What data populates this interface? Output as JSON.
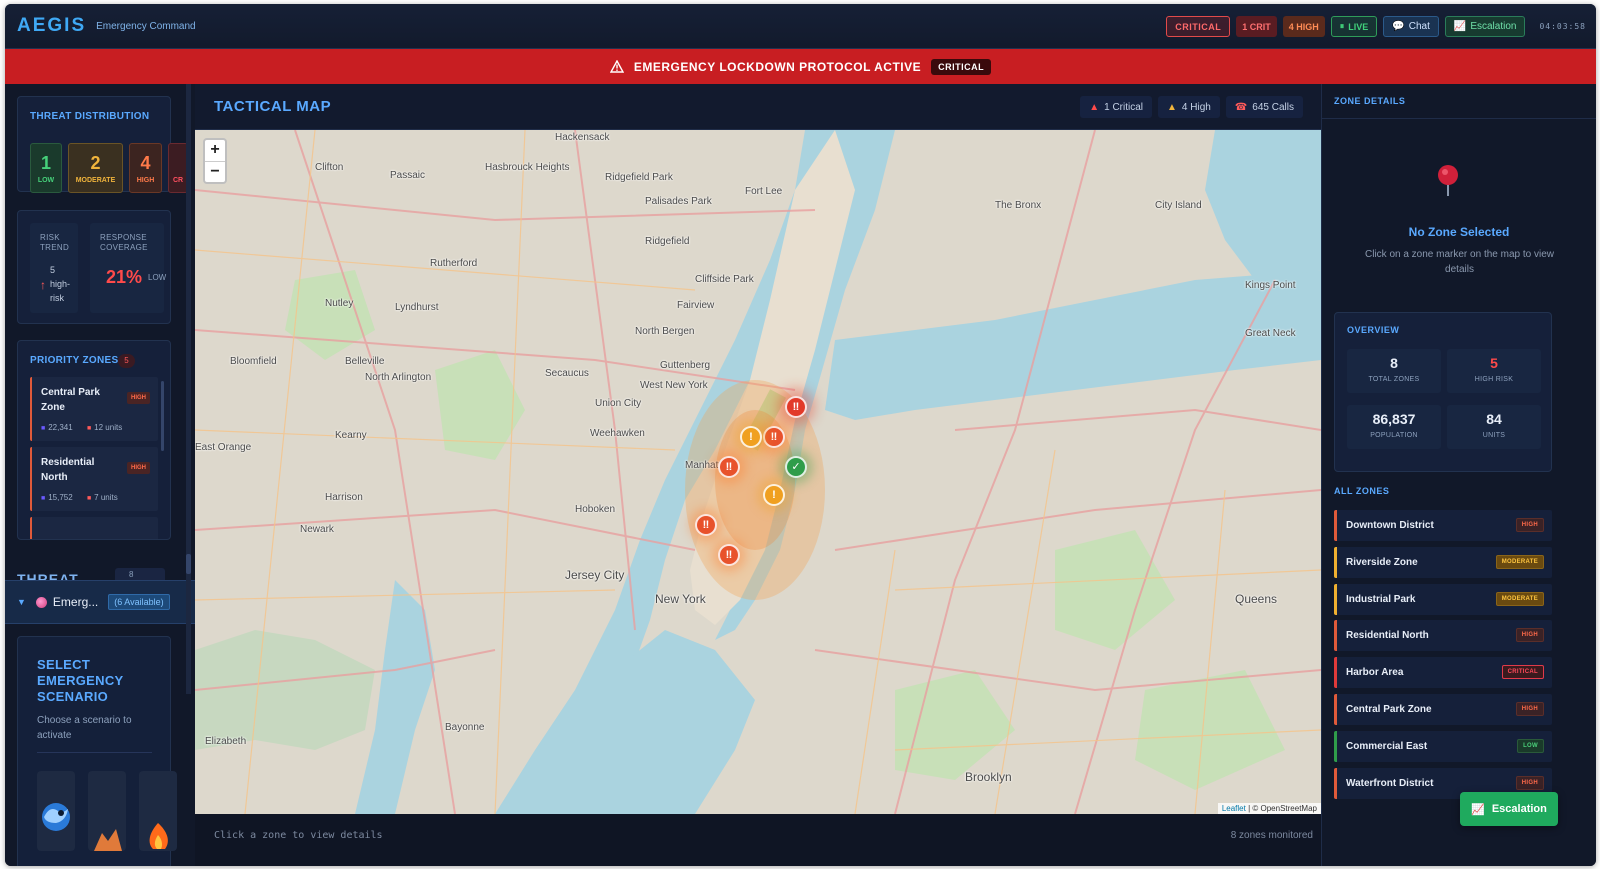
{
  "header": {
    "logo": "AEGIS",
    "subtitle": "Emergency Command",
    "critical_pill": "CRITICAL",
    "crit_count": "1 CRIT",
    "high_count": "4 HIGH",
    "live": "LIVE",
    "chat": "Chat",
    "escalation": "Escalation",
    "clock": "04:03:58"
  },
  "banner": {
    "text": "EMERGENCY LOCKDOWN PROTOCOL ACTIVE",
    "badge": "CRITICAL"
  },
  "left": {
    "threat_distribution": {
      "title": "THREAT DISTRIBUTION",
      "low": {
        "value": "1",
        "label": "LOW"
      },
      "moderate": {
        "value": "2",
        "label": "MODERATE"
      },
      "high": {
        "value": "4",
        "label": "HIGH"
      },
      "critical_partial": "CR"
    },
    "risk": {
      "trend_label": "RISK TREND",
      "trend_value": "5 high-risk",
      "coverage_label": "RESPONSE COVERAGE",
      "coverage_value": "21%",
      "coverage_level": "LOW"
    },
    "priority_zones": {
      "title": "PRIORITY ZONES",
      "count": "5",
      "items": [
        {
          "name": "Central Park Zone",
          "badge": "HIGH",
          "population": "22,341",
          "units": "12 units"
        },
        {
          "name": "Residential North",
          "badge": "HIGH",
          "population": "15,752",
          "units": "7 units"
        }
      ]
    },
    "threat_section": {
      "label": "THREAT",
      "count": "8"
    },
    "emergency_row": {
      "label": "Emerg...",
      "available": "(6 Available)"
    },
    "scenario": {
      "title": "SELECT EMERGENCY SCENARIO",
      "subtitle": "Choose a scenario to activate"
    }
  },
  "map": {
    "title": "TACTICAL MAP",
    "stats": {
      "critical": "1 Critical",
      "high": "4 High",
      "calls": "645 Calls"
    },
    "zoom_in": "+",
    "zoom_out": "−",
    "attribution_leaflet": "Leaflet",
    "attribution_osm": "| © OpenStreetMap",
    "labels": [
      "Clifton",
      "Passaic",
      "Hackensack",
      "Hasbrouck Heights",
      "Ridgefield Park",
      "Palisades Park",
      "Fort Lee",
      "Rutherford",
      "Ridgefield",
      "Cliffside Park",
      "Fairview",
      "Nutley",
      "Lyndhurst",
      "North Bergen",
      "Guttenberg",
      "West New York",
      "Bloomfield",
      "Belleville",
      "North Arlington",
      "Secaucus",
      "Union City",
      "Weehawken",
      "Kearny",
      "East Orange",
      "Harrison",
      "Hoboken",
      "Newark",
      "Jersey City",
      "New York",
      "Bayonne",
      "Elizabeth",
      "The Bronx",
      "City Island",
      "Kings Point",
      "Great Neck",
      "Queens",
      "Brooklyn",
      "Manhattan"
    ],
    "markers": [
      {
        "type": "critical",
        "glyph": "‼"
      },
      {
        "type": "high",
        "glyph": "‼"
      },
      {
        "type": "moderate",
        "glyph": "!"
      },
      {
        "type": "high",
        "glyph": "‼"
      },
      {
        "type": "low",
        "glyph": "✓"
      },
      {
        "type": "moderate",
        "glyph": "!"
      },
      {
        "type": "high",
        "glyph": "‼"
      },
      {
        "type": "high",
        "glyph": "‼"
      }
    ],
    "footer_left": "Click a zone to view details",
    "footer_right": "8 zones monitored"
  },
  "right": {
    "title": "ZONE DETAILS",
    "no_zone_title": "No Zone Selected",
    "no_zone_sub": "Click on a zone marker on the map to view details",
    "overview": {
      "title": "OVERVIEW",
      "total_zones": {
        "value": "8",
        "label": "TOTAL ZONES"
      },
      "high_risk": {
        "value": "5",
        "label": "HIGH RISK"
      },
      "population": {
        "value": "86,837",
        "label": "POPULATION"
      },
      "units": {
        "value": "84",
        "label": "UNITS"
      }
    },
    "all_zones_title": "ALL ZONES",
    "zones": [
      {
        "name": "Downtown District",
        "level": "HIGH"
      },
      {
        "name": "Riverside Zone",
        "level": "MODERATE"
      },
      {
        "name": "Industrial Park",
        "level": "MODERATE"
      },
      {
        "name": "Residential North",
        "level": "HIGH"
      },
      {
        "name": "Harbor Area",
        "level": "CRITICAL"
      },
      {
        "name": "Central Park Zone",
        "level": "HIGH"
      },
      {
        "name": "Commercial East",
        "level": "LOW"
      },
      {
        "name": "Waterfront District",
        "level": "HIGH"
      }
    ],
    "escalation_button": "Escalation"
  },
  "colors": {
    "accent": "#5aa9ff",
    "critical": "#c81e22",
    "high": "#ff6a4a",
    "moderate": "#f0b43c",
    "low": "#46d07a"
  }
}
